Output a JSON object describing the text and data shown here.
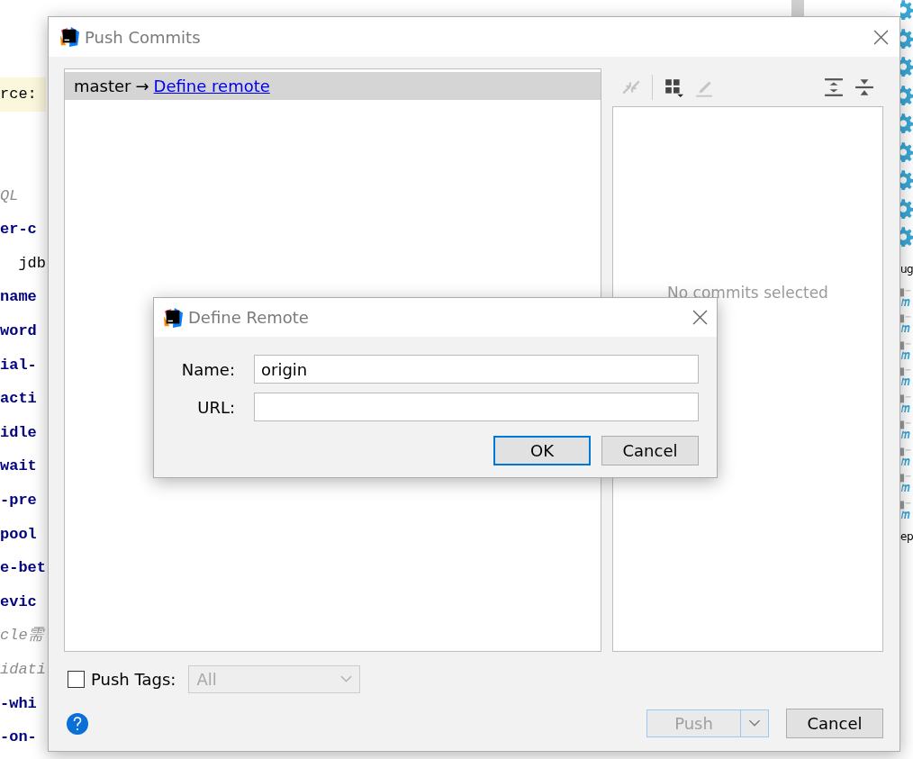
{
  "editor": {
    "lines": [
      {
        "text": "rce:",
        "kind": "highlight"
      },
      {
        "text": "QL",
        "kind": "comment"
      },
      {
        "text": "er-c",
        "kind": "key"
      },
      {
        "text": "  jdb",
        "kind": "plain"
      },
      {
        "text": "name",
        "kind": "key"
      },
      {
        "text": "word",
        "kind": "key"
      },
      {
        "text": "ial-",
        "kind": "key"
      },
      {
        "text": "acti",
        "kind": "key"
      },
      {
        "text": "idle",
        "kind": "key"
      },
      {
        "text": "wait",
        "kind": "key"
      },
      {
        "text": "-pre",
        "kind": "key"
      },
      {
        "text": "pool",
        "kind": "key"
      },
      {
        "text": "e-bet",
        "kind": "key"
      },
      {
        "text": "evic",
        "kind": "key"
      },
      {
        "text": "cle需",
        "kind": "comment"
      },
      {
        "text": "idati",
        "kind": "comment"
      },
      {
        "text": "-whi",
        "kind": "key"
      },
      {
        "text": "-on-",
        "kind": "key"
      }
    ]
  },
  "side_panel": {
    "labels": [
      {
        "text": "ug"
      },
      {
        "text": "ep"
      }
    ]
  },
  "push_dialog": {
    "title": "Push Commits",
    "branch": {
      "name": "master",
      "arrow": "→",
      "link": "Define remote"
    },
    "empty_text": "No commits selected",
    "push_tags": {
      "label": "Push Tags:",
      "checked": false,
      "value": "All",
      "disabled": true
    },
    "buttons": [
      {
        "label": "Push",
        "disabled": true
      },
      {
        "label": "Cancel",
        "disabled": false
      }
    ]
  },
  "remote_dialog": {
    "title": "Define Remote",
    "fields": [
      {
        "label": "Name:",
        "value": "origin"
      },
      {
        "label": "URL:"
      }
    ],
    "buttons": [
      {
        "label": "OK",
        "selected": true
      },
      {
        "label": "Cancel",
        "selected": false
      }
    ]
  }
}
